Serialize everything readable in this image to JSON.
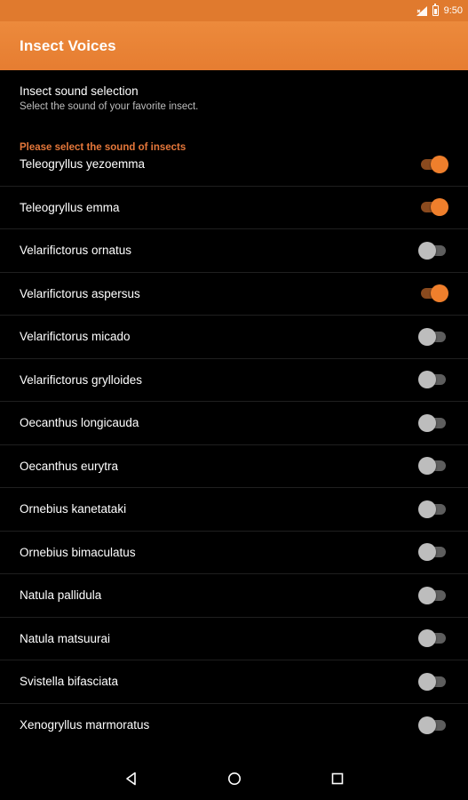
{
  "status_bar": {
    "time": "9:50",
    "icons": [
      "signal-icon",
      "battery-icon"
    ]
  },
  "app_bar": {
    "title": "Insect Voices"
  },
  "intro": {
    "title": "Insect sound selection",
    "subtitle": "Select the sound of your favorite insect."
  },
  "category": {
    "label": "Please select the sound of insects"
  },
  "insects": [
    {
      "name": "Teleogryllus yezoemma",
      "enabled": true
    },
    {
      "name": "Teleogryllus emma",
      "enabled": true
    },
    {
      "name": "Velarifictorus ornatus",
      "enabled": false
    },
    {
      "name": "Velarifictorus aspersus",
      "enabled": true
    },
    {
      "name": "Velarifictorus micado",
      "enabled": false
    },
    {
      "name": "Velarifictorus grylloides",
      "enabled": false
    },
    {
      "name": "Oecanthus longicauda",
      "enabled": false
    },
    {
      "name": "Oecanthus eurytra",
      "enabled": false
    },
    {
      "name": "Ornebius kanetataki",
      "enabled": false
    },
    {
      "name": "Ornebius bimaculatus",
      "enabled": false
    },
    {
      "name": "Natula pallidula",
      "enabled": false
    },
    {
      "name": "Natula matsuurai",
      "enabled": false
    },
    {
      "name": "Svistella bifasciata",
      "enabled": false
    },
    {
      "name": "Xenogryllus marmoratus",
      "enabled": false
    }
  ],
  "colors": {
    "accent": "#e5773a",
    "app_bar": "#e67d31",
    "background": "#000000"
  },
  "nav": {
    "buttons": [
      "back-icon",
      "home-icon",
      "recents-icon"
    ]
  }
}
